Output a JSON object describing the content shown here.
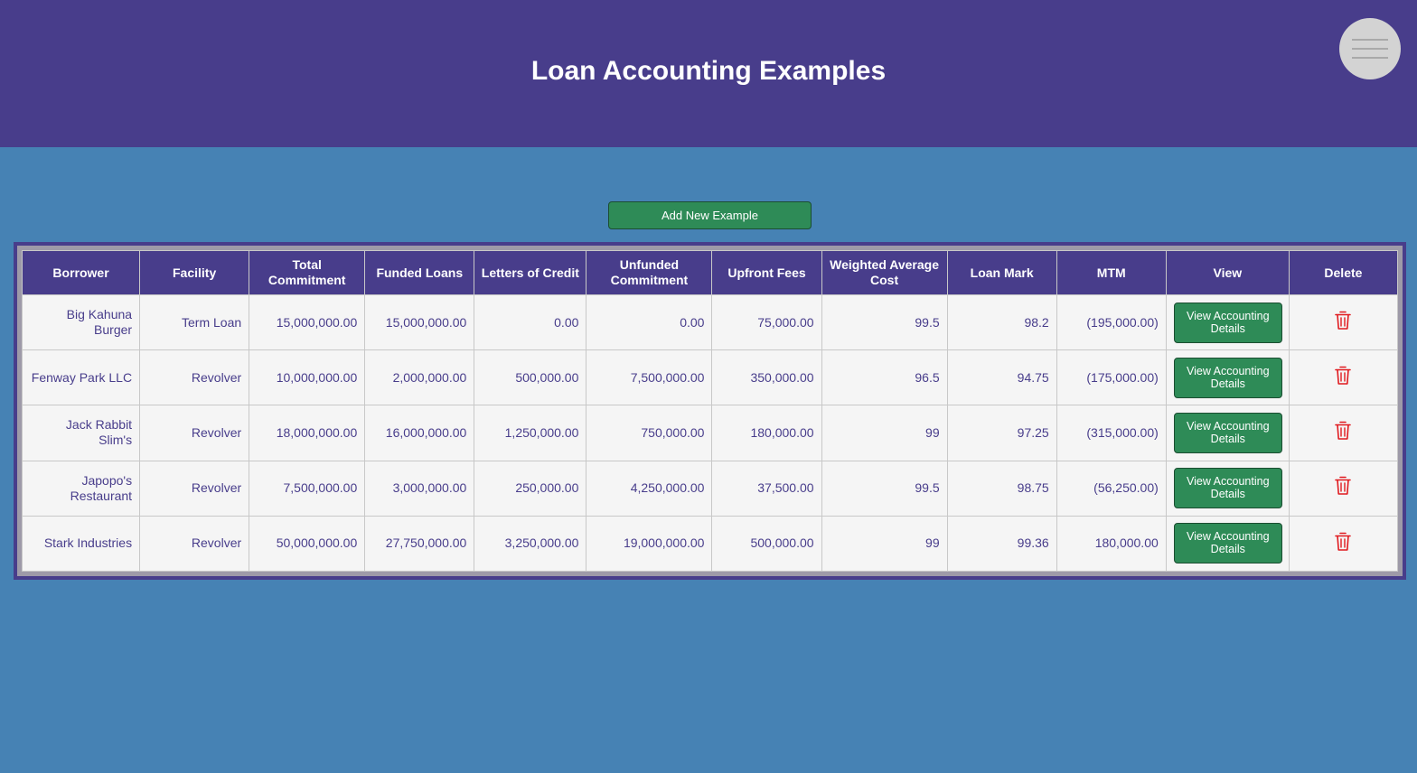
{
  "header": {
    "title": "Loan Accounting Examples"
  },
  "menu": {
    "icon": "hamburger-menu-icon"
  },
  "toolbar": {
    "add_label": "Add New Example"
  },
  "table": {
    "columns": [
      "Borrower",
      "Facility",
      "Total Commitment",
      "Funded Loans",
      "Letters of Credit",
      "Unfunded Commitment",
      "Upfront Fees",
      "Weighted Average Cost",
      "Loan Mark",
      "MTM",
      "View",
      "Delete"
    ],
    "rows": [
      {
        "borrower": "Big Kahuna Burger",
        "facility": "Term Loan",
        "total_commitment": "15,000,000.00",
        "funded_loans": "15,000,000.00",
        "letters_of_credit": "0.00",
        "unfunded_commitment": "0.00",
        "upfront_fees": "75,000.00",
        "weighted_average_cost": "99.5",
        "loan_mark": "98.2",
        "mtm": "(195,000.00)",
        "view_label": "View Accounting Details"
      },
      {
        "borrower": "Fenway Park LLC",
        "facility": "Revolver",
        "total_commitment": "10,000,000.00",
        "funded_loans": "2,000,000.00",
        "letters_of_credit": "500,000.00",
        "unfunded_commitment": "7,500,000.00",
        "upfront_fees": "350,000.00",
        "weighted_average_cost": "96.5",
        "loan_mark": "94.75",
        "mtm": "(175,000.00)",
        "view_label": "View Accounting Details"
      },
      {
        "borrower": "Jack Rabbit Slim's",
        "facility": "Revolver",
        "total_commitment": "18,000,000.00",
        "funded_loans": "16,000,000.00",
        "letters_of_credit": "1,250,000.00",
        "unfunded_commitment": "750,000.00",
        "upfront_fees": "180,000.00",
        "weighted_average_cost": "99",
        "loan_mark": "97.25",
        "mtm": "(315,000.00)",
        "view_label": "View Accounting Details"
      },
      {
        "borrower": "Japopo's Restaurant",
        "facility": "Revolver",
        "total_commitment": "7,500,000.00",
        "funded_loans": "3,000,000.00",
        "letters_of_credit": "250,000.00",
        "unfunded_commitment": "4,250,000.00",
        "upfront_fees": "37,500.00",
        "weighted_average_cost": "99.5",
        "loan_mark": "98.75",
        "mtm": "(56,250.00)",
        "view_label": "View Accounting Details"
      },
      {
        "borrower": "Stark Industries",
        "facility": "Revolver",
        "total_commitment": "50,000,000.00",
        "funded_loans": "27,750,000.00",
        "letters_of_credit": "3,250,000.00",
        "unfunded_commitment": "19,000,000.00",
        "upfront_fees": "500,000.00",
        "weighted_average_cost": "99",
        "loan_mark": "99.36",
        "mtm": "180,000.00",
        "view_label": "View Accounting Details"
      }
    ]
  },
  "colors": {
    "header_bg": "#483d8b",
    "page_bg": "#4682b4",
    "button_green": "#2e8b57",
    "delete_red": "#e0191e"
  }
}
